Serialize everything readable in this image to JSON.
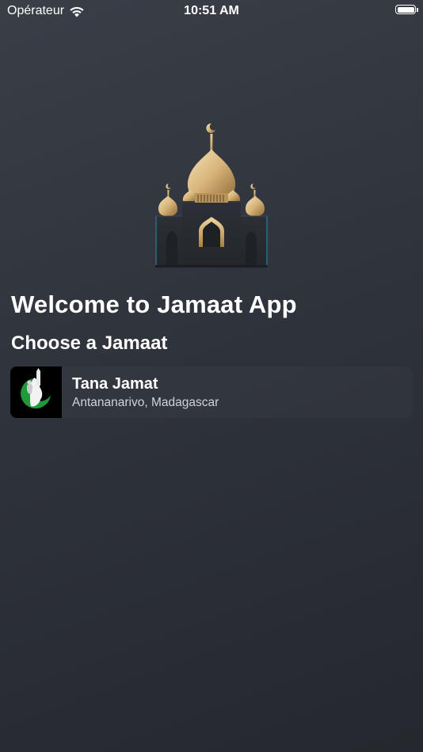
{
  "status_bar": {
    "carrier": "Opérateur",
    "time": "10:51 AM",
    "wifi_icon": "wifi-icon",
    "battery_icon": "battery-icon"
  },
  "header": {
    "welcome": "Welcome to Jamaat App",
    "choose": "Choose a Jamaat",
    "illustration_icon": "mosque-icon"
  },
  "jamaats": [
    {
      "name": "Tana Jamat",
      "location": "Antananarivo, Madagascar",
      "logo_icon": "jamaat-logo-icon"
    }
  ],
  "colors": {
    "background": "#2f333b",
    "gold": "#d8b57a",
    "logo_green": "#1f9a3a"
  }
}
